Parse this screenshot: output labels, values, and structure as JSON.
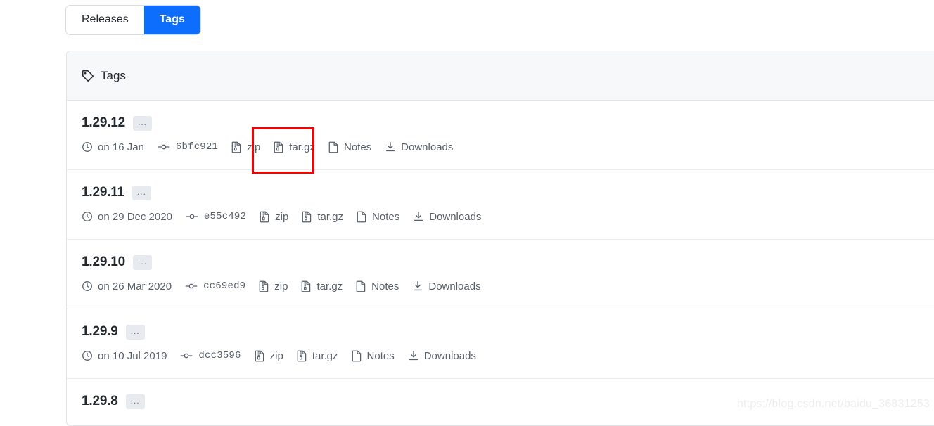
{
  "tabs": [
    {
      "label": "Releases",
      "active": false
    },
    {
      "label": "Tags",
      "active": true
    }
  ],
  "panel": {
    "header_title": "Tags"
  },
  "tags": [
    {
      "version": "1.29.12",
      "menu_badge": "...",
      "date": "on 16 Jan",
      "commit": "6bfc921",
      "zip_label": "zip",
      "targz_label": "tar.gz",
      "notes_label": "Notes",
      "downloads_label": "Downloads"
    },
    {
      "version": "1.29.11",
      "menu_badge": "...",
      "date": "on 29 Dec 2020",
      "commit": "e55c492",
      "zip_label": "zip",
      "targz_label": "tar.gz",
      "notes_label": "Notes",
      "downloads_label": "Downloads"
    },
    {
      "version": "1.29.10",
      "menu_badge": "...",
      "date": "on 26 Mar 2020",
      "commit": "cc69ed9",
      "zip_label": "zip",
      "targz_label": "tar.gz",
      "notes_label": "Notes",
      "downloads_label": "Downloads"
    },
    {
      "version": "1.29.9",
      "menu_badge": "...",
      "date": "on 10 Jul 2019",
      "commit": "dcc3596",
      "zip_label": "zip",
      "targz_label": "tar.gz",
      "notes_label": "Notes",
      "downloads_label": "Downloads"
    },
    {
      "version": "1.29.8",
      "menu_badge": "...",
      "date": "",
      "commit": "",
      "zip_label": "",
      "targz_label": "",
      "notes_label": "",
      "downloads_label": ""
    }
  ],
  "annotation": {
    "target": "tar.gz",
    "color": "#fa0000"
  },
  "watermark": "https://blog.csdn.net/baidu_36831253",
  "colors": {
    "accent_blue": "#0d6efd",
    "header_bg": "#f6f8fa",
    "border": "#e1e4e8",
    "text_primary": "#24292e",
    "text_muted": "#586069"
  }
}
